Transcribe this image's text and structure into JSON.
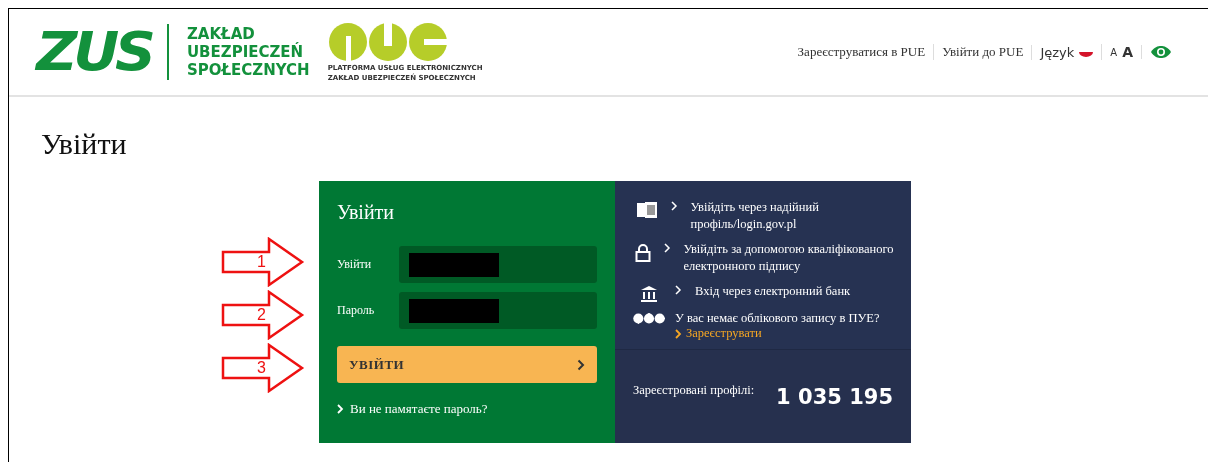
{
  "header": {
    "logo": {
      "mark": "ZUS",
      "name_lines": [
        "ZAKŁAD",
        "UBEZPIECZEŃ",
        "SPOŁECZNYCH"
      ],
      "pue_caption": "PLATFORMA USŁUG ELEKTRONICZNYCH",
      "pue_subcaption": "ZAKŁAD UBEZPIECZEŃ SPOŁECZNYCH"
    },
    "nav": [
      {
        "kind": "link",
        "label": "Зареєструватися в PUE"
      },
      {
        "kind": "link",
        "label": "Увійти до PUE"
      },
      {
        "kind": "language",
        "label": "Język"
      },
      {
        "kind": "fontsize",
        "label": "A",
        "label_large": "A"
      },
      {
        "kind": "contrast"
      }
    ]
  },
  "page_title": "Увійти",
  "annotations": [
    {
      "number": "1"
    },
    {
      "number": "2"
    },
    {
      "number": "3"
    }
  ],
  "login": {
    "title": "Увійти",
    "fields": [
      {
        "label": "Увійти",
        "redacted": true
      },
      {
        "label": "Пароль",
        "redacted": true
      }
    ],
    "submit": "УВІЙТИ",
    "forgot": "Ви не памятаєте пароль?"
  },
  "methods": [
    {
      "kind": "profile",
      "label": "Увійдіть через надійний профіль/login.gov.pl"
    },
    {
      "kind": "signature",
      "label": "Увійдіть за допомогою кваліфікованого електронного підпису"
    },
    {
      "kind": "bank",
      "label": "Вхід через електронний банк"
    }
  ],
  "register": {
    "question": "У вас немає облікового запису в ПУЕ?",
    "link": "Зареєструвати"
  },
  "stats": {
    "label": "Зареєстровані профілі:",
    "value": "1 035 195"
  }
}
